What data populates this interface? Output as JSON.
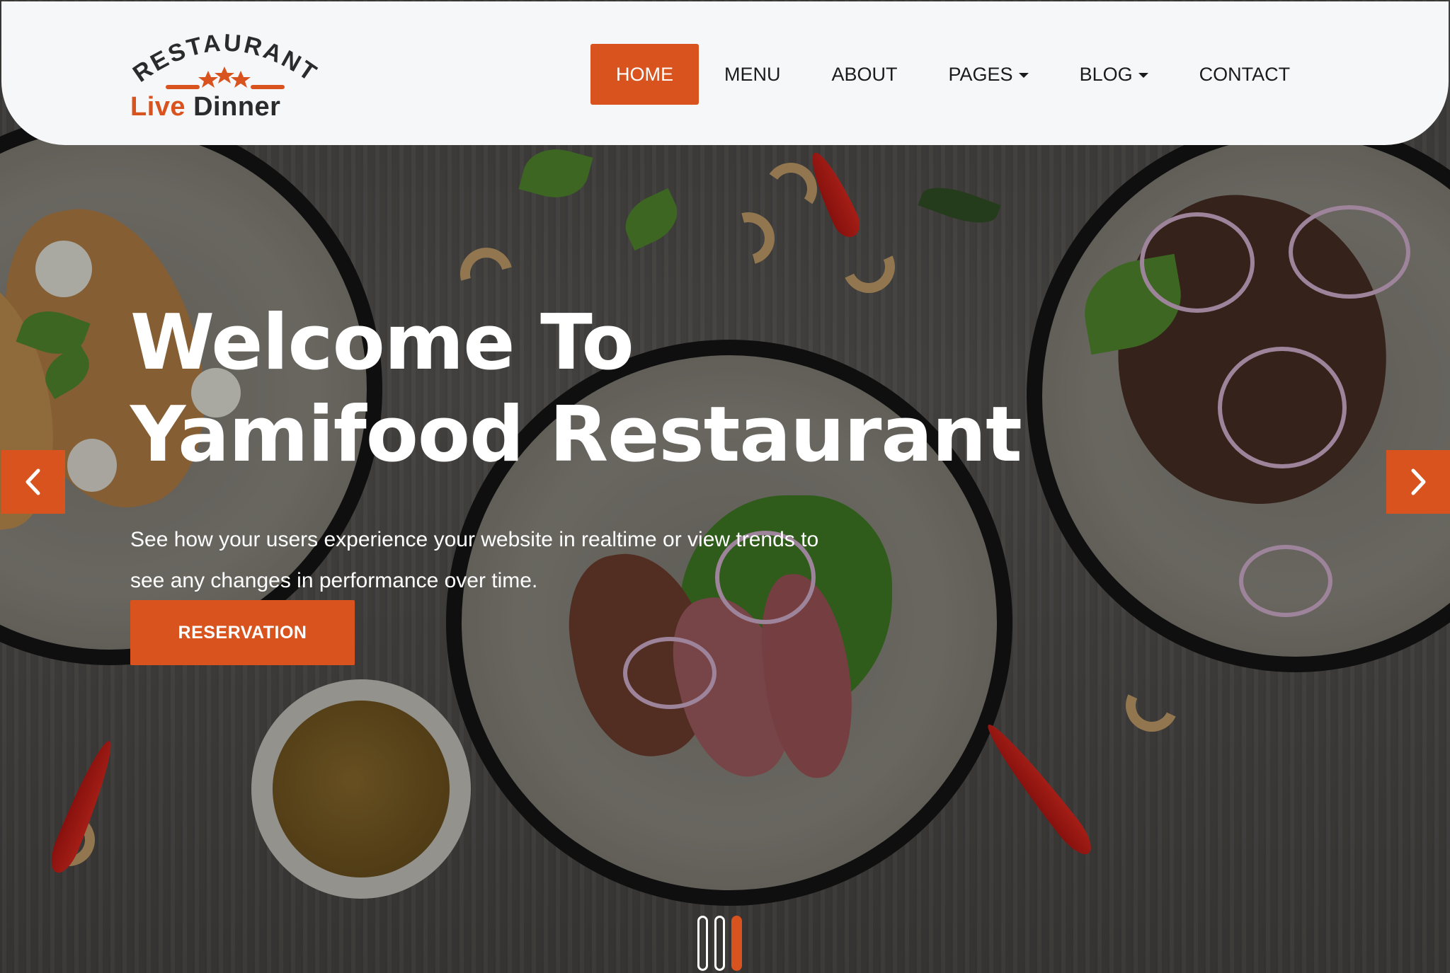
{
  "brand": {
    "logo_arc_text": "RESTAURANT",
    "logo_name_part1": "Live",
    "logo_name_part2": "Dinner",
    "accent_color": "#d9531e"
  },
  "nav": {
    "items": [
      {
        "label": "HOME",
        "active": true,
        "dropdown": false
      },
      {
        "label": "MENU",
        "active": false,
        "dropdown": false
      },
      {
        "label": "ABOUT",
        "active": false,
        "dropdown": false
      },
      {
        "label": "PAGES",
        "active": false,
        "dropdown": true
      },
      {
        "label": "BLOG",
        "active": false,
        "dropdown": true
      },
      {
        "label": "CONTACT",
        "active": false,
        "dropdown": false
      }
    ]
  },
  "hero": {
    "title_line1": "Welcome To",
    "title_line2": "Yamifood Restaurant",
    "subtitle": "See how your users experience your website in realtime or view trends to see any changes in performance over time.",
    "cta_label": "RESERVATION",
    "prev_icon": "chevron-left-icon",
    "next_icon": "chevron-right-icon"
  },
  "carousel": {
    "slide_count": 3,
    "active_index": 2
  }
}
